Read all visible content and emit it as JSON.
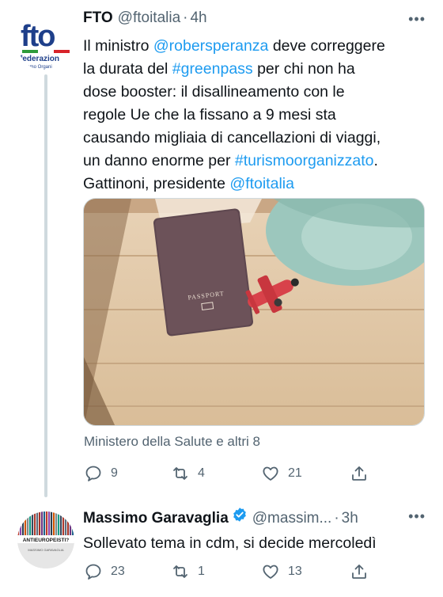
{
  "tweet1": {
    "display_name": "FTO",
    "handle": "@ftoitalia",
    "separator": "·",
    "time": "4h",
    "avatar": {
      "logo_text": "fto",
      "sub1": "federazion",
      "sub2": "urismo Organi"
    },
    "text_lines": [
      [
        {
          "t": "Il ministro "
        },
        {
          "t": "@robersperanza",
          "link": true
        },
        {
          "t": " deve correggere"
        }
      ],
      [
        {
          "t": "la durata del "
        },
        {
          "t": "#greenpass",
          "link": true
        },
        {
          "t": " per chi non ha"
        }
      ],
      [
        {
          "t": "dose booster: il disallineamento con le"
        }
      ],
      [
        {
          "t": "regole Ue che la fissano a 9 mesi sta"
        }
      ],
      [
        {
          "t": "causando migliaia di cancellazioni di viaggi,"
        }
      ],
      [
        {
          "t": "un danno enorme per "
        },
        {
          "t": "#turismoorganizzato",
          "link": true
        },
        {
          "t": "."
        }
      ],
      [
        {
          "t": "Gattinoni, presidente "
        },
        {
          "t": "@ftoitalia",
          "link": true
        }
      ]
    ],
    "media": {
      "passport_label": "PASSPORT"
    },
    "liked_by": "Ministero della Salute e altri 8",
    "replies": "9",
    "retweets": "4",
    "likes": "21"
  },
  "tweet2": {
    "display_name": "Massimo Garavaglia",
    "handle": "@massim...",
    "separator": "·",
    "time": "3h",
    "avatar": {
      "banner": "ANTIEUROPEISTI?",
      "caption": "MASSIMO GARAVAGLIA"
    },
    "text": "Sollevato tema in cdm, si decide mercoledì",
    "replies": "23",
    "retweets": "1",
    "likes": "13"
  },
  "colors": {
    "link": "#1d9bf0",
    "secondary": "#536471",
    "line": "#cfd9de",
    "verified": "#1d9bf0"
  }
}
